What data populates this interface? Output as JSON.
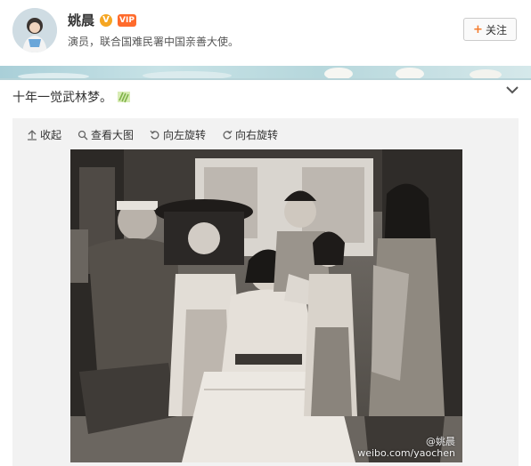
{
  "profile": {
    "name": "姚晨",
    "verified_badge": "V",
    "vip_badge": "VIP",
    "bio": "演员，联合国难民署中国亲善大使。",
    "follow_label": "关注",
    "follow_icon": "plus-icon"
  },
  "post": {
    "text": "十年一觉武林梦。",
    "emoji": "sticker-emoji-icon",
    "menu_icon": "chevron-down-icon"
  },
  "media_toolbar": {
    "collapse": "收起",
    "view_large": "查看大图",
    "rotate_left": "向左旋转",
    "rotate_right": "向右旋转"
  },
  "photo": {
    "description_type": "group-photo-black-and-white",
    "watermark_line1": "@姚晨",
    "watermark_line2": "weibo.com/yaochen"
  },
  "colors": {
    "accent": "#f57b2c",
    "verified": "#f5a623",
    "card_bg": "#f2f2f2"
  }
}
